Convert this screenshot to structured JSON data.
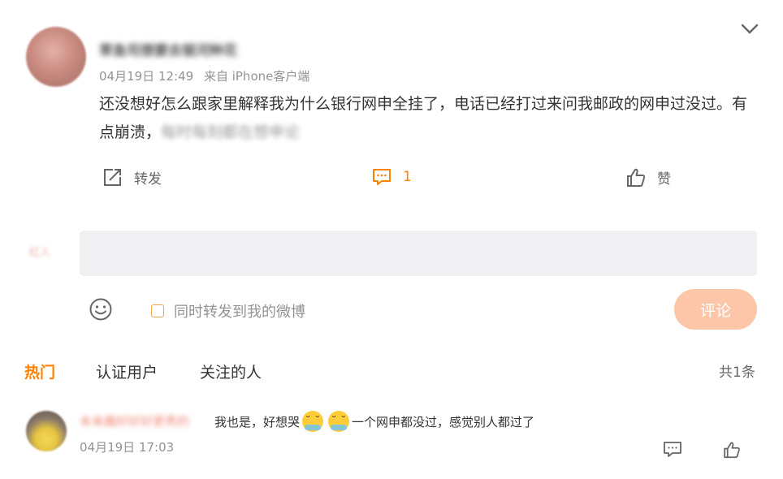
{
  "post": {
    "username": "草鱼司想要去银河种花",
    "time": "04月19日 12:49",
    "source": "来自 iPhone客户端",
    "text_visible": "还没想好怎么跟家里解释我为什么银行网申全挂了，电话已经打过来问我邮政的网申过没过。有点崩溃，",
    "text_blurred": "每时每刻都在想申论"
  },
  "actions": {
    "repost_label": "转发",
    "comment_count": "1",
    "like_label": "赞"
  },
  "compose": {
    "placeholder": "",
    "repost_option": "同时转发到我的微博",
    "submit_label": "评论",
    "user_tag": "红人"
  },
  "tabs": {
    "items": [
      "热门",
      "认证用户",
      "关注的人"
    ],
    "active": "热门",
    "total": "共1条"
  },
  "comments": [
    {
      "username": "未来趣好好好更秀的",
      "text_before": "我也是，好想哭",
      "emoji": [
        "crying-face",
        "crying-face"
      ],
      "text_after": "一个网申都没过，感觉别人都过了",
      "time": "04月19日 17:03"
    }
  ],
  "colors": {
    "accent": "#ff8200",
    "button_disabled": "#fdc6a8",
    "muted": "#939393"
  }
}
